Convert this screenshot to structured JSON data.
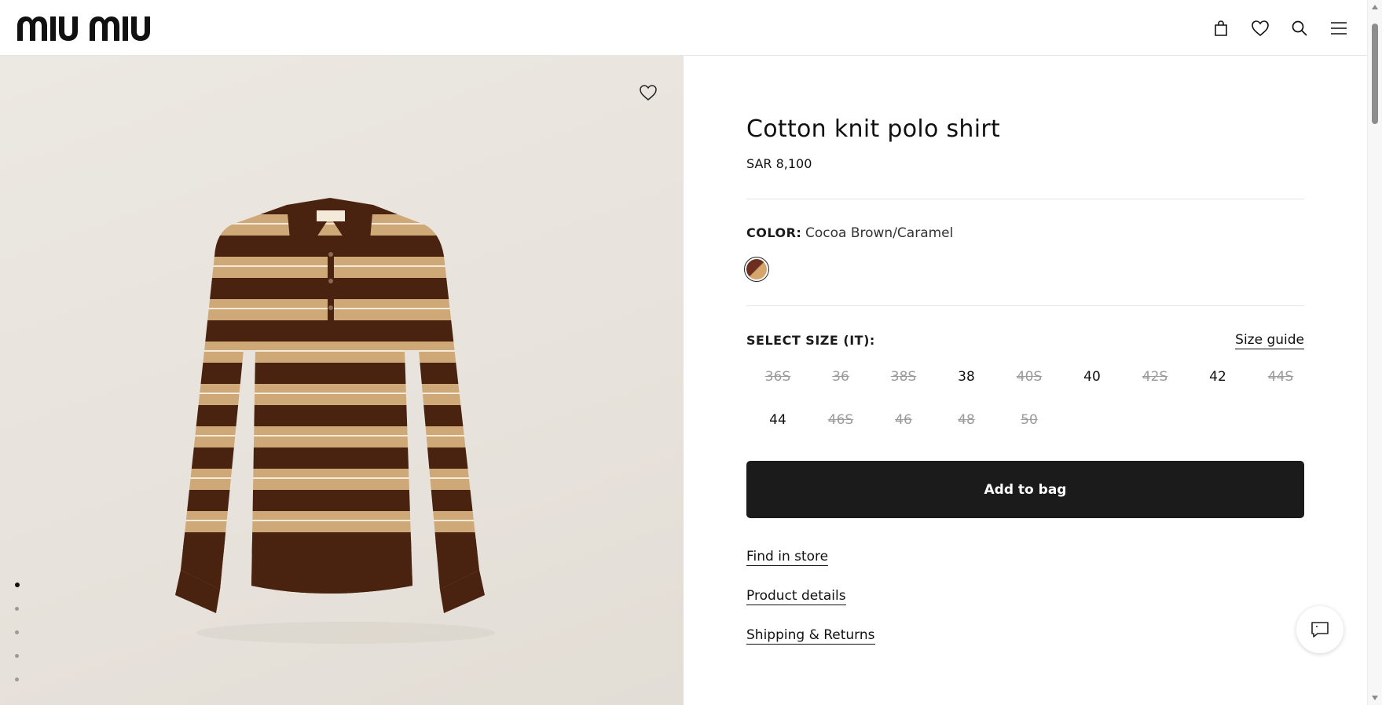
{
  "brand": {
    "name": "miu miu",
    "logo_icon": "miu-miu-logo"
  },
  "header": {
    "icons": [
      "shopping-bag-icon",
      "heart-icon",
      "search-icon",
      "menu-icon"
    ]
  },
  "gallery": {
    "wishlist_icon": "heart-icon",
    "dots_count": 5,
    "active_dot": 1
  },
  "product": {
    "title": "Cotton knit polo shirt",
    "price": "SAR 8,100",
    "color_label": "COLOR:",
    "color_value": "Cocoa Brown/Caramel",
    "swatch_colors": [
      "#6b2e1f",
      "#d6a56c"
    ],
    "size_label": "SELECT SIZE (IT):",
    "size_guide": "Size guide",
    "sizes": [
      {
        "label": "36S",
        "available": false
      },
      {
        "label": "36",
        "available": false
      },
      {
        "label": "38S",
        "available": false
      },
      {
        "label": "38",
        "available": true
      },
      {
        "label": "40S",
        "available": false
      },
      {
        "label": "40",
        "available": true
      },
      {
        "label": "42S",
        "available": false
      },
      {
        "label": "42",
        "available": true
      },
      {
        "label": "44S",
        "available": false
      },
      {
        "label": "44",
        "available": true
      },
      {
        "label": "46S",
        "available": false
      },
      {
        "label": "46",
        "available": false
      },
      {
        "label": "48",
        "available": false
      },
      {
        "label": "50",
        "available": false
      }
    ],
    "add_to_bag": "Add to bag",
    "links": {
      "find_in_store": "Find in store",
      "product_details": "Product details",
      "shipping_returns": "Shipping & Returns"
    }
  },
  "chat": {
    "icon": "chat-icon"
  },
  "colors": {
    "button_bg": "#1b1b1b",
    "unavailable_text": "#9b9b9b"
  }
}
